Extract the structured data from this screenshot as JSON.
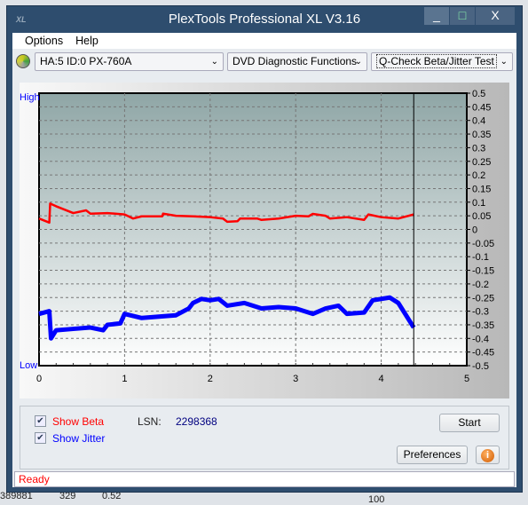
{
  "window": {
    "title": "PlexTools Professional XL V3.16",
    "logo": "XL",
    "minimize": "_",
    "maximize": "□",
    "close": "X"
  },
  "menu": [
    "Options",
    "Help"
  ],
  "toolbar": {
    "drive": "HA:5 ID:0  PX-760A",
    "category": "DVD Diagnostic Functions",
    "test": "Q-Check Beta/Jitter Test",
    "drive_icon": "disc-icon"
  },
  "chart_data": {
    "type": "line",
    "xlim": [
      0,
      5
    ],
    "ylim": [
      -0.5,
      0.5
    ],
    "x_ticks": [
      "0",
      "1",
      "2",
      "3",
      "4",
      "5"
    ],
    "y_ticks": [
      "0.5",
      "0.45",
      "0.4",
      "0.35",
      "0.3",
      "0.25",
      "0.2",
      "0.15",
      "0.1",
      "0.05",
      "0",
      "-0.05",
      "-0.1",
      "-0.15",
      "-0.2",
      "-0.25",
      "-0.3",
      "-0.35",
      "-0.4",
      "-0.45",
      "-0.5"
    ],
    "left_labels": {
      "high": "High",
      "low": "Low"
    },
    "grid": true,
    "position_marker": 4.38,
    "series": [
      {
        "color": "#ff0000",
        "points": [
          [
            0,
            0.04
          ],
          [
            0.12,
            0.025
          ],
          [
            0.13,
            0.095
          ],
          [
            0.2,
            0.085
          ],
          [
            0.4,
            0.06
          ],
          [
            0.55,
            0.07
          ],
          [
            0.6,
            0.058
          ],
          [
            0.8,
            0.06
          ],
          [
            1.0,
            0.055
          ],
          [
            1.1,
            0.04
          ],
          [
            1.2,
            0.048
          ],
          [
            1.44,
            0.048
          ],
          [
            1.45,
            0.058
          ],
          [
            1.6,
            0.05
          ],
          [
            1.8,
            0.048
          ],
          [
            2.0,
            0.045
          ],
          [
            2.15,
            0.04
          ],
          [
            2.2,
            0.028
          ],
          [
            2.32,
            0.03
          ],
          [
            2.35,
            0.04
          ],
          [
            2.55,
            0.04
          ],
          [
            2.6,
            0.035
          ],
          [
            2.8,
            0.04
          ],
          [
            3.0,
            0.05
          ],
          [
            3.15,
            0.048
          ],
          [
            3.2,
            0.057
          ],
          [
            3.35,
            0.05
          ],
          [
            3.4,
            0.04
          ],
          [
            3.6,
            0.045
          ],
          [
            3.8,
            0.035
          ],
          [
            3.85,
            0.055
          ],
          [
            4.0,
            0.045
          ],
          [
            4.2,
            0.04
          ],
          [
            4.38,
            0.055
          ]
        ]
      },
      {
        "color": "#0000ff",
        "points": [
          [
            0,
            -0.31
          ],
          [
            0.12,
            -0.3
          ],
          [
            0.14,
            -0.4
          ],
          [
            0.2,
            -0.37
          ],
          [
            0.4,
            -0.365
          ],
          [
            0.6,
            -0.36
          ],
          [
            0.75,
            -0.37
          ],
          [
            0.8,
            -0.35
          ],
          [
            0.95,
            -0.345
          ],
          [
            1.0,
            -0.31
          ],
          [
            1.2,
            -0.325
          ],
          [
            1.4,
            -0.32
          ],
          [
            1.6,
            -0.315
          ],
          [
            1.75,
            -0.29
          ],
          [
            1.8,
            -0.27
          ],
          [
            1.9,
            -0.255
          ],
          [
            2.0,
            -0.26
          ],
          [
            2.1,
            -0.255
          ],
          [
            2.2,
            -0.28
          ],
          [
            2.4,
            -0.27
          ],
          [
            2.6,
            -0.29
          ],
          [
            2.8,
            -0.285
          ],
          [
            3.0,
            -0.29
          ],
          [
            3.2,
            -0.31
          ],
          [
            3.35,
            -0.29
          ],
          [
            3.5,
            -0.28
          ],
          [
            3.6,
            -0.31
          ],
          [
            3.8,
            -0.305
          ],
          [
            3.9,
            -0.26
          ],
          [
            4.1,
            -0.25
          ],
          [
            4.2,
            -0.27
          ],
          [
            4.3,
            -0.32
          ],
          [
            4.38,
            -0.36
          ]
        ]
      }
    ]
  },
  "controls": {
    "show_beta": "Show Beta",
    "show_jitter": "Show Jitter",
    "beta_checked": true,
    "jitter_checked": true,
    "lsn_label": "LSN:",
    "lsn_value": "2298368",
    "start": "Start",
    "preferences": "Preferences",
    "info_icon": "info-icon"
  },
  "status": "Ready",
  "background_text": [
    "389881",
    "329",
    "0.52",
    "100"
  ]
}
